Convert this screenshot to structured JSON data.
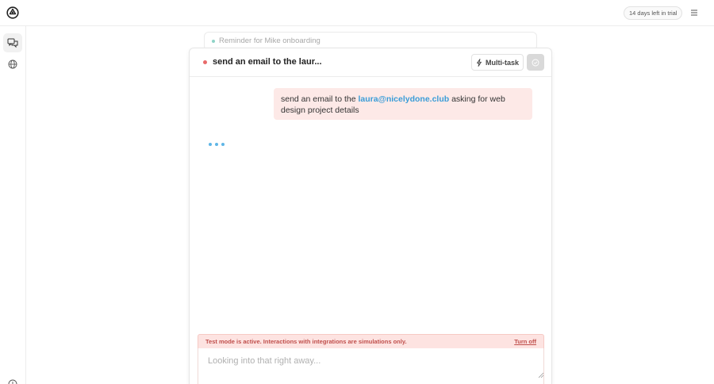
{
  "topbar": {
    "logo_icon": "app-logo-icon",
    "trial_label": "14 days left in trial",
    "menu_icon": "hamburger-menu-icon"
  },
  "sidebar": {
    "items": [
      {
        "icon": "chat-bubbles-icon",
        "active": true
      },
      {
        "icon": "globe-icon",
        "active": false
      },
      {
        "icon": "help-circle-icon",
        "active": false
      }
    ]
  },
  "background_task": {
    "title": "Reminder for Mike onboarding"
  },
  "task": {
    "title": "send an email to the laur...",
    "multitask_label": "Multi-task",
    "multitask_icon": "lightning-bolt-icon",
    "done_icon": "check-circle-icon"
  },
  "conversation": {
    "user_message": {
      "before": "send an email to the",
      "email": "laura@nicelydone.club",
      "after": "asking for web design project details"
    }
  },
  "test_mode": {
    "message": "Test mode is active. Interactions with integrations are simulations only.",
    "action_label": "Turn off"
  },
  "composer": {
    "placeholder": "Looking into that right away...",
    "value": ""
  },
  "colors": {
    "accent_blue": "#3a9dd8",
    "status_red": "#e86a6a",
    "banner_bg": "#fde3e1",
    "message_bg": "#fde9e7"
  }
}
